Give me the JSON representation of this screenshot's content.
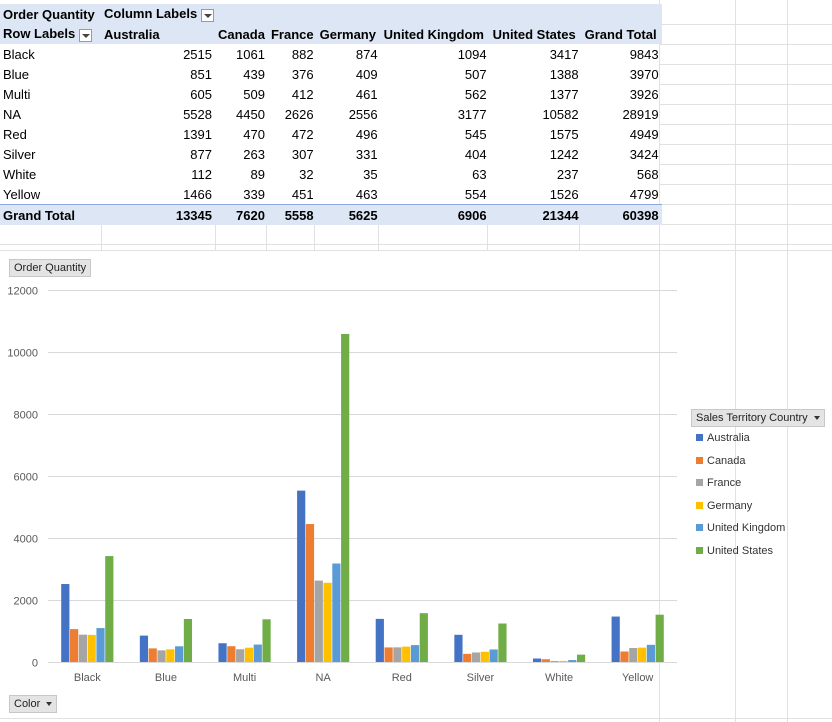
{
  "pivot": {
    "value_field": "Order Quantity",
    "column_labels": "Column Labels",
    "row_labels": "Row Labels",
    "columns": [
      "Australia",
      "Canada",
      "France",
      "Germany",
      "United Kingdom",
      "United States",
      "Grand Total"
    ],
    "rows": [
      {
        "label": "Black",
        "values": [
          "2515",
          "1061",
          "882",
          "874",
          "1094",
          "3417",
          "9843"
        ]
      },
      {
        "label": "Blue",
        "values": [
          "851",
          "439",
          "376",
          "409",
          "507",
          "1388",
          "3970"
        ]
      },
      {
        "label": "Multi",
        "values": [
          "605",
          "509",
          "412",
          "461",
          "562",
          "1377",
          "3926"
        ]
      },
      {
        "label": "NA",
        "values": [
          "5528",
          "4450",
          "2626",
          "2556",
          "3177",
          "10582",
          "28919"
        ]
      },
      {
        "label": "Red",
        "values": [
          "1391",
          "470",
          "472",
          "496",
          "545",
          "1575",
          "4949"
        ]
      },
      {
        "label": "Silver",
        "values": [
          "877",
          "263",
          "307",
          "331",
          "404",
          "1242",
          "3424"
        ]
      },
      {
        "label": "White",
        "values": [
          "112",
          "89",
          "32",
          "35",
          "63",
          "237",
          "568"
        ]
      },
      {
        "label": "Yellow",
        "values": [
          "1466",
          "339",
          "451",
          "463",
          "554",
          "1526",
          "4799"
        ]
      }
    ],
    "total": {
      "label": "Grand Total",
      "values": [
        "13345",
        "7620",
        "5558",
        "5625",
        "6906",
        "21344",
        "60398"
      ]
    }
  },
  "chart_buttons": {
    "value": "Order Quantity",
    "legend": "Sales Territory Country",
    "axis": "Color"
  },
  "chart_data": {
    "type": "bar",
    "categories": [
      "Black",
      "Blue",
      "Multi",
      "NA",
      "Red",
      "Silver",
      "White",
      "Yellow"
    ],
    "series": [
      {
        "name": "Australia",
        "color": "#4472c4",
        "values": [
          2515,
          851,
          605,
          5528,
          1391,
          877,
          112,
          1466
        ]
      },
      {
        "name": "Canada",
        "color": "#ed7d31",
        "values": [
          1061,
          439,
          509,
          4450,
          470,
          263,
          89,
          339
        ]
      },
      {
        "name": "France",
        "color": "#a5a5a5",
        "values": [
          882,
          376,
          412,
          2626,
          472,
          307,
          32,
          451
        ]
      },
      {
        "name": "Germany",
        "color": "#ffc000",
        "values": [
          874,
          409,
          461,
          2556,
          496,
          331,
          35,
          463
        ]
      },
      {
        "name": "United Kingdom",
        "color": "#5b9bd5",
        "values": [
          1094,
          507,
          562,
          3177,
          545,
          404,
          63,
          554
        ]
      },
      {
        "name": "United States",
        "color": "#70ad47",
        "values": [
          3417,
          1388,
          1377,
          10582,
          1575,
          1242,
          237,
          1526
        ]
      }
    ],
    "ylim": [
      0,
      12000
    ],
    "yticks": [
      "0",
      "2000",
      "4000",
      "6000",
      "8000",
      "10000",
      "12000"
    ],
    "grid": true,
    "legend_position": "right"
  }
}
